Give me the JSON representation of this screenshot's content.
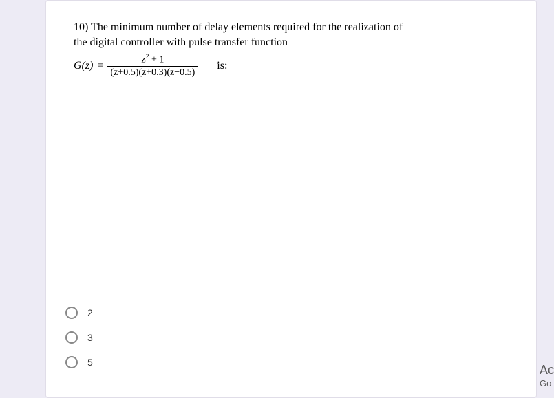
{
  "question": {
    "number": "10)",
    "text_line1": "The minimum number of delay elements required for the realization of",
    "text_line2": "the  digital controller  with pulse  transfer function",
    "gz": "G(z)",
    "equals": "=",
    "numerator_html": "z² + 1",
    "denominator_html": "(z+0.5)(z+0.3)(z−0.5)",
    "is_text": "is:"
  },
  "options": [
    {
      "label": "2"
    },
    {
      "label": "3"
    },
    {
      "label": "5"
    }
  ],
  "side": {
    "ac": "Ac",
    "go": "Go"
  }
}
